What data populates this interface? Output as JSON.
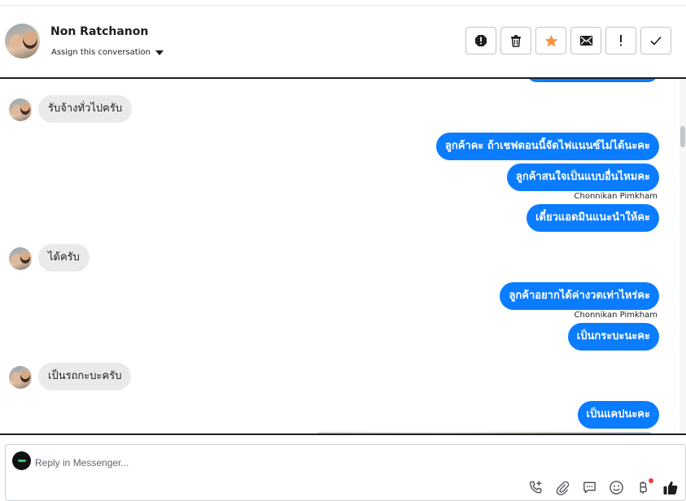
{
  "header": {
    "contact_name": "Non Ratchanon",
    "assign_label": "Assign this conversation"
  },
  "actions": [
    {
      "name": "report-spam",
      "icon": "alert-octagon-icon"
    },
    {
      "name": "delete",
      "icon": "trash-icon"
    },
    {
      "name": "star",
      "icon": "star-icon"
    },
    {
      "name": "mark-unread",
      "icon": "envelope-icon"
    },
    {
      "name": "follow-up",
      "icon": "exclamation-icon"
    },
    {
      "name": "mark-done",
      "icon": "check-icon"
    }
  ],
  "messages": [
    {
      "from": "contact",
      "text": "รับจ้างทั่วไปครับ"
    },
    {
      "from": "page",
      "text": "ลูกค้าคะ ถ้าเชฟตอนนี้จัดไฟแนนซ์ไม่ได้นะคะ"
    },
    {
      "from": "page",
      "text": "ลูกค้าสนใจเป็นแบบอื่นไหมคะ",
      "sender": "Chonnikan Pimkham"
    },
    {
      "from": "page",
      "text": "เดี๋ยวแอดมินแนะนำให้คะ"
    },
    {
      "from": "contact",
      "text": "ได้ครับ"
    },
    {
      "from": "page",
      "text": "ลูกค้าอยากได้ค่างวดเท่าไหร่คะ",
      "sender": "Chonnikan Pimkham"
    },
    {
      "from": "page",
      "text": "เป็นกระบะนะคะ"
    },
    {
      "from": "contact",
      "text": "เป็นรถกะบะครับ"
    },
    {
      "from": "page",
      "text": "เป็นแคปนะคะ"
    }
  ],
  "composer": {
    "placeholder": "Reply in Messenger...",
    "tools": [
      "phone-plus-icon",
      "paperclip-icon",
      "speech-bubble-icon",
      "smile-icon",
      "baht-icon",
      "thumbs-up-icon"
    ]
  },
  "colors": {
    "outgoing_bubble": "#0a7cff",
    "incoming_bubble": "#e9eaec",
    "star": "#f7923b"
  }
}
